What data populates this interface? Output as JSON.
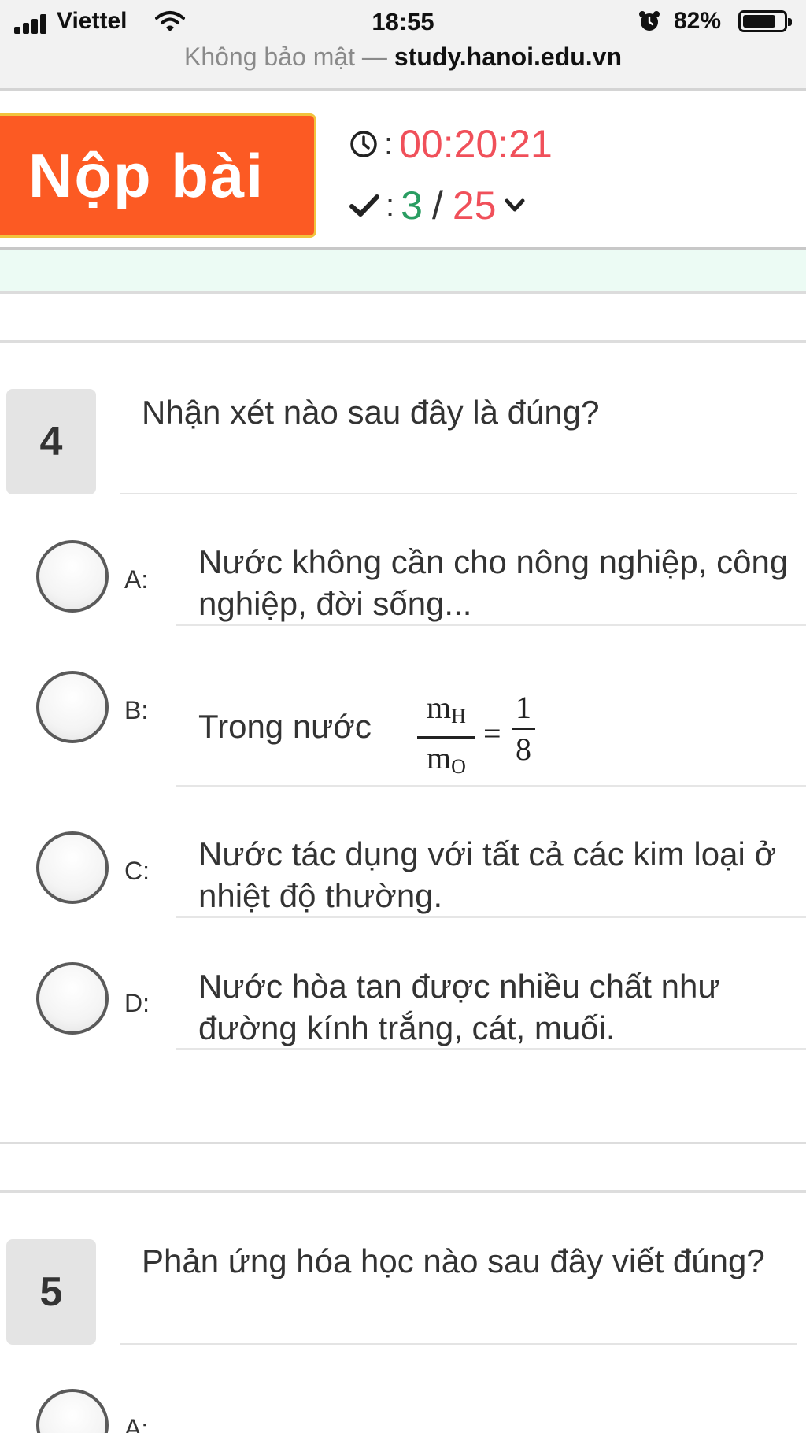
{
  "status_bar": {
    "carrier": "Viettel",
    "time": "18:55",
    "battery": "82%",
    "battery_level": 0.82
  },
  "url_bar": {
    "prefix": "Không bảo mật — ",
    "domain": "study.hanoi.edu.vn"
  },
  "exam_header": {
    "submit_label": "Nộp bài",
    "timer": "00:20:21",
    "separator": ":",
    "answered": "3",
    "total": "25"
  },
  "questions": [
    {
      "number": "4",
      "text": "Nhận xét nào sau đây là đúng?",
      "options": [
        {
          "label": "A:",
          "text": "Nước không cần cho nông nghiệp, công nghiệp, đời sống..."
        },
        {
          "label": "B:",
          "text": "Trong nước",
          "formula": {
            "lhs_num": "m",
            "lhs_num_sub": "H",
            "lhs_den": "m",
            "lhs_den_sub": "O",
            "eq": "=",
            "rhs_num": "1",
            "rhs_den": "8"
          }
        },
        {
          "label": "C:",
          "text": "Nước tác dụng với tất cả các kim loại ở nhiệt độ thường."
        },
        {
          "label": "D:",
          "text": "Nước hòa tan được nhiều chất như đường kính trắng, cát, muối."
        }
      ]
    },
    {
      "number": "5",
      "text": "Phản ứng hóa học nào sau đây viết đúng?",
      "options": [
        {
          "label": "A:"
        }
      ]
    }
  ],
  "icons": {
    "signal": "signal-bars-icon",
    "wifi": "wifi-icon",
    "alarm": "alarm-icon",
    "battery": "battery-icon",
    "timer": "clock-icon",
    "progress": "check-icon",
    "expand": "chevron-down-icon"
  },
  "colors": {
    "submit_bg": "#fc5a23",
    "submit_border": "#f2c33d",
    "timer": "#f0505a",
    "answered": "#2a9d62",
    "total": "#f0505a",
    "band": "#ecfbf4"
  }
}
